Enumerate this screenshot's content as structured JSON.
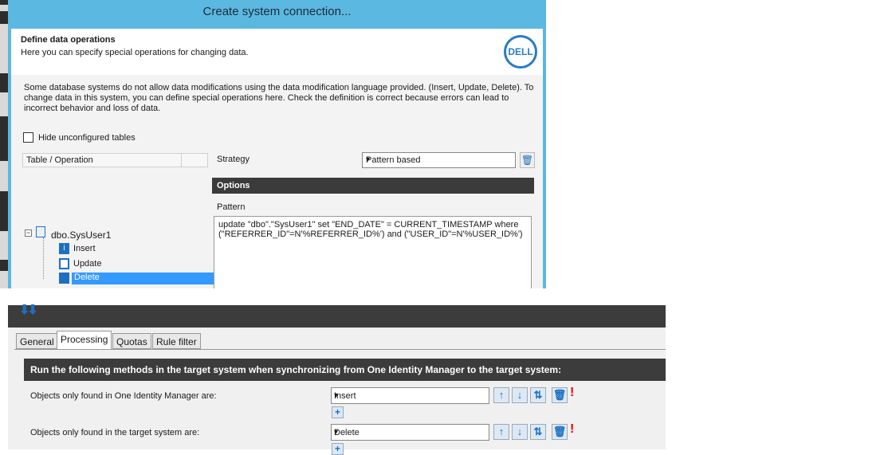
{
  "dialog": {
    "title": "Create system connection...",
    "heading": "Define data operations",
    "subheading": "Here you can specify special operations for changing data.",
    "logo_text": "DELL",
    "warning": "Some database systems do not allow data modifications using the data modification language provided. (Insert, Update, Delete). To change data in this system, you can define special operations here. Check the definition is correct because errors can lead to incorrect behavior and loss of data.",
    "hide_unconfigured_label": "Hide unconfigured tables",
    "hide_unconfigured_checked": false,
    "table_header": "Table / Operation",
    "tree": {
      "root": "dbo.SysUser1",
      "items": [
        {
          "label": "Insert",
          "icon": "insert-icon"
        },
        {
          "label": "Update",
          "icon": "edit-icon"
        },
        {
          "label": "Delete",
          "icon": "delete-icon",
          "selected": true
        }
      ]
    },
    "strategy_label": "Strategy",
    "strategy_value": "Pattern based",
    "options_label": "Options",
    "pattern_label": "Pattern",
    "pattern_value": "update \"dbo\".\"SysUser1\"  set \"END_DATE\" = CURRENT_TIMESTAMP where (\"REFERRER_ID\"=N'%REFERRER_ID%') and (\"USER_ID\"=N'%USER_ID%')"
  },
  "bottom": {
    "tabs": [
      {
        "label": "General",
        "active": false
      },
      {
        "label": "Processing",
        "active": true
      },
      {
        "label": "Quotas",
        "active": false
      },
      {
        "label": "Rule filter",
        "active": false
      }
    ],
    "header": "Run the following methods in the target system when synchronizing from One Identity Manager to the target system:",
    "rows": [
      {
        "label": "Objects only found in One Identity Manager are:",
        "value": "Insert"
      },
      {
        "label": "Objects only found in the target system are:",
        "value": "Delete"
      }
    ]
  },
  "colors": {
    "title_bar": "#5bb8e0",
    "accent": "#1e6fc1",
    "dark_bar": "#3c3c3c",
    "warning_mark": "#ee0000"
  }
}
